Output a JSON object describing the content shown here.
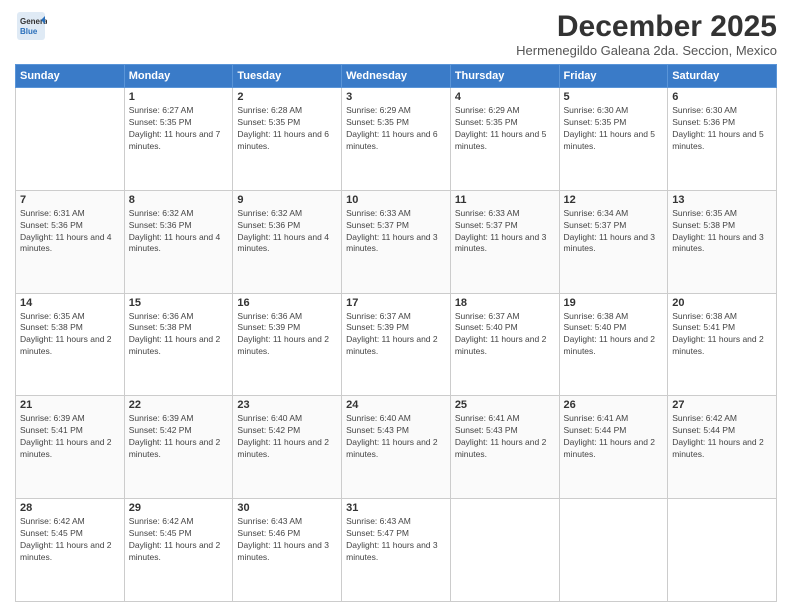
{
  "header": {
    "logo": {
      "general": "General",
      "blue": "Blue"
    },
    "title": "December 2025",
    "location": "Hermenegildo Galeana 2da. Seccion, Mexico"
  },
  "weekdays": [
    "Sunday",
    "Monday",
    "Tuesday",
    "Wednesday",
    "Thursday",
    "Friday",
    "Saturday"
  ],
  "weeks": [
    [
      {
        "day": "",
        "sunrise": "",
        "sunset": "",
        "daylight": ""
      },
      {
        "day": "1",
        "sunrise": "Sunrise: 6:27 AM",
        "sunset": "Sunset: 5:35 PM",
        "daylight": "Daylight: 11 hours and 7 minutes."
      },
      {
        "day": "2",
        "sunrise": "Sunrise: 6:28 AM",
        "sunset": "Sunset: 5:35 PM",
        "daylight": "Daylight: 11 hours and 6 minutes."
      },
      {
        "day": "3",
        "sunrise": "Sunrise: 6:29 AM",
        "sunset": "Sunset: 5:35 PM",
        "daylight": "Daylight: 11 hours and 6 minutes."
      },
      {
        "day": "4",
        "sunrise": "Sunrise: 6:29 AM",
        "sunset": "Sunset: 5:35 PM",
        "daylight": "Daylight: 11 hours and 5 minutes."
      },
      {
        "day": "5",
        "sunrise": "Sunrise: 6:30 AM",
        "sunset": "Sunset: 5:35 PM",
        "daylight": "Daylight: 11 hours and 5 minutes."
      },
      {
        "day": "6",
        "sunrise": "Sunrise: 6:30 AM",
        "sunset": "Sunset: 5:36 PM",
        "daylight": "Daylight: 11 hours and 5 minutes."
      }
    ],
    [
      {
        "day": "7",
        "sunrise": "Sunrise: 6:31 AM",
        "sunset": "Sunset: 5:36 PM",
        "daylight": "Daylight: 11 hours and 4 minutes."
      },
      {
        "day": "8",
        "sunrise": "Sunrise: 6:32 AM",
        "sunset": "Sunset: 5:36 PM",
        "daylight": "Daylight: 11 hours and 4 minutes."
      },
      {
        "day": "9",
        "sunrise": "Sunrise: 6:32 AM",
        "sunset": "Sunset: 5:36 PM",
        "daylight": "Daylight: 11 hours and 4 minutes."
      },
      {
        "day": "10",
        "sunrise": "Sunrise: 6:33 AM",
        "sunset": "Sunset: 5:37 PM",
        "daylight": "Daylight: 11 hours and 3 minutes."
      },
      {
        "day": "11",
        "sunrise": "Sunrise: 6:33 AM",
        "sunset": "Sunset: 5:37 PM",
        "daylight": "Daylight: 11 hours and 3 minutes."
      },
      {
        "day": "12",
        "sunrise": "Sunrise: 6:34 AM",
        "sunset": "Sunset: 5:37 PM",
        "daylight": "Daylight: 11 hours and 3 minutes."
      },
      {
        "day": "13",
        "sunrise": "Sunrise: 6:35 AM",
        "sunset": "Sunset: 5:38 PM",
        "daylight": "Daylight: 11 hours and 3 minutes."
      }
    ],
    [
      {
        "day": "14",
        "sunrise": "Sunrise: 6:35 AM",
        "sunset": "Sunset: 5:38 PM",
        "daylight": "Daylight: 11 hours and 2 minutes."
      },
      {
        "day": "15",
        "sunrise": "Sunrise: 6:36 AM",
        "sunset": "Sunset: 5:38 PM",
        "daylight": "Daylight: 11 hours and 2 minutes."
      },
      {
        "day": "16",
        "sunrise": "Sunrise: 6:36 AM",
        "sunset": "Sunset: 5:39 PM",
        "daylight": "Daylight: 11 hours and 2 minutes."
      },
      {
        "day": "17",
        "sunrise": "Sunrise: 6:37 AM",
        "sunset": "Sunset: 5:39 PM",
        "daylight": "Daylight: 11 hours and 2 minutes."
      },
      {
        "day": "18",
        "sunrise": "Sunrise: 6:37 AM",
        "sunset": "Sunset: 5:40 PM",
        "daylight": "Daylight: 11 hours and 2 minutes."
      },
      {
        "day": "19",
        "sunrise": "Sunrise: 6:38 AM",
        "sunset": "Sunset: 5:40 PM",
        "daylight": "Daylight: 11 hours and 2 minutes."
      },
      {
        "day": "20",
        "sunrise": "Sunrise: 6:38 AM",
        "sunset": "Sunset: 5:41 PM",
        "daylight": "Daylight: 11 hours and 2 minutes."
      }
    ],
    [
      {
        "day": "21",
        "sunrise": "Sunrise: 6:39 AM",
        "sunset": "Sunset: 5:41 PM",
        "daylight": "Daylight: 11 hours and 2 minutes."
      },
      {
        "day": "22",
        "sunrise": "Sunrise: 6:39 AM",
        "sunset": "Sunset: 5:42 PM",
        "daylight": "Daylight: 11 hours and 2 minutes."
      },
      {
        "day": "23",
        "sunrise": "Sunrise: 6:40 AM",
        "sunset": "Sunset: 5:42 PM",
        "daylight": "Daylight: 11 hours and 2 minutes."
      },
      {
        "day": "24",
        "sunrise": "Sunrise: 6:40 AM",
        "sunset": "Sunset: 5:43 PM",
        "daylight": "Daylight: 11 hours and 2 minutes."
      },
      {
        "day": "25",
        "sunrise": "Sunrise: 6:41 AM",
        "sunset": "Sunset: 5:43 PM",
        "daylight": "Daylight: 11 hours and 2 minutes."
      },
      {
        "day": "26",
        "sunrise": "Sunrise: 6:41 AM",
        "sunset": "Sunset: 5:44 PM",
        "daylight": "Daylight: 11 hours and 2 minutes."
      },
      {
        "day": "27",
        "sunrise": "Sunrise: 6:42 AM",
        "sunset": "Sunset: 5:44 PM",
        "daylight": "Daylight: 11 hours and 2 minutes."
      }
    ],
    [
      {
        "day": "28",
        "sunrise": "Sunrise: 6:42 AM",
        "sunset": "Sunset: 5:45 PM",
        "daylight": "Daylight: 11 hours and 2 minutes."
      },
      {
        "day": "29",
        "sunrise": "Sunrise: 6:42 AM",
        "sunset": "Sunset: 5:45 PM",
        "daylight": "Daylight: 11 hours and 2 minutes."
      },
      {
        "day": "30",
        "sunrise": "Sunrise: 6:43 AM",
        "sunset": "Sunset: 5:46 PM",
        "daylight": "Daylight: 11 hours and 3 minutes."
      },
      {
        "day": "31",
        "sunrise": "Sunrise: 6:43 AM",
        "sunset": "Sunset: 5:47 PM",
        "daylight": "Daylight: 11 hours and 3 minutes."
      },
      {
        "day": "",
        "sunrise": "",
        "sunset": "",
        "daylight": ""
      },
      {
        "day": "",
        "sunrise": "",
        "sunset": "",
        "daylight": ""
      },
      {
        "day": "",
        "sunrise": "",
        "sunset": "",
        "daylight": ""
      }
    ]
  ]
}
